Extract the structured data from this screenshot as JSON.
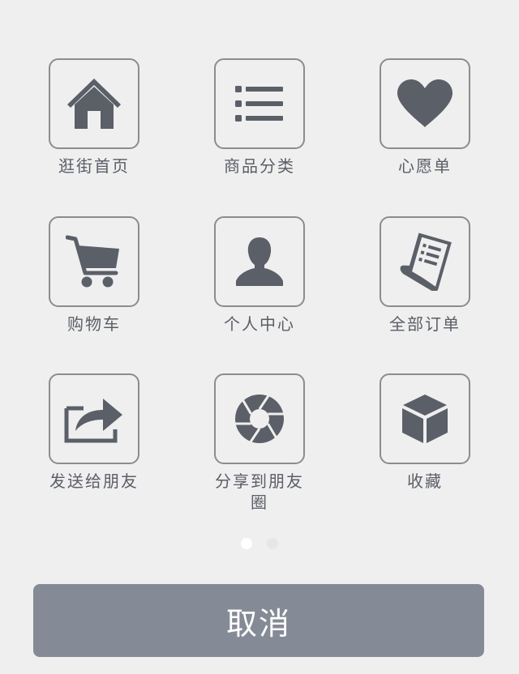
{
  "colors": {
    "background": "#efefef",
    "icon": "#5b5f68",
    "tile_border": "#8c8c8c",
    "label": "#5a5e66",
    "cancel_bg": "#858b96",
    "cancel_text": "#ffffff",
    "dot_active": "#ffffff",
    "dot_inactive": "#e6e6e6"
  },
  "menu": {
    "items": [
      {
        "label": "逛街首页",
        "icon": "home-icon"
      },
      {
        "label": "商品分类",
        "icon": "list-icon"
      },
      {
        "label": "心愿单",
        "icon": "heart-icon"
      },
      {
        "label": "购物车",
        "icon": "cart-icon"
      },
      {
        "label": "个人中心",
        "icon": "user-icon"
      },
      {
        "label": "全部订单",
        "icon": "receipt-icon"
      },
      {
        "label": "发送给朋友",
        "icon": "share-icon"
      },
      {
        "label": "分享到朋友圈",
        "icon": "aperture-icon"
      },
      {
        "label": "收藏",
        "icon": "box-icon"
      }
    ]
  },
  "pager": {
    "current_page": 1,
    "total_pages": 2
  },
  "cancel_label": "取消"
}
